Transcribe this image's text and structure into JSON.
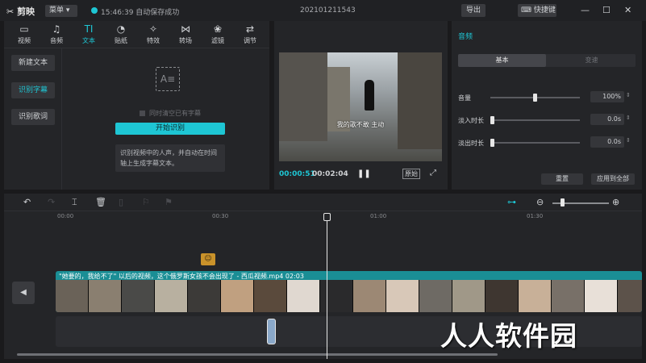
{
  "titlebar": {
    "logo": "剪映",
    "menu_label": "菜单",
    "save_status": "15:46:39 自动保存成功",
    "project_title": "202101211543",
    "export_label": "导出",
    "hotkey_label": "快捷键"
  },
  "media_panel": {
    "tabs": [
      {
        "label": "视频",
        "icon": "▭"
      },
      {
        "label": "音频",
        "icon": "♫"
      },
      {
        "label": "文本",
        "icon": "TI"
      },
      {
        "label": "贴纸",
        "icon": "◔"
      },
      {
        "label": "特效",
        "icon": "✧"
      },
      {
        "label": "转场",
        "icon": "⋈"
      },
      {
        "label": "滤镜",
        "icon": "❀"
      },
      {
        "label": "调节",
        "icon": "⇄"
      }
    ],
    "active_tab": "文本",
    "sidebar": [
      {
        "label": "新建文本"
      },
      {
        "label": "识别字幕"
      },
      {
        "label": "识别歌词"
      }
    ],
    "active_sidebar": "识别字幕",
    "ai_icon_glyph": "A≡",
    "checkbox_label": "同时清空已有字幕",
    "start_button": "开始识别",
    "hint": "识别视频中的人声，并自动在时间轴上生成字幕文本。"
  },
  "player": {
    "subtitle": "我的歌不敢  主动",
    "current_time": "00:00:51",
    "duration": "00:02:04",
    "original_label": "原始"
  },
  "properties": {
    "title": "音频",
    "segments": [
      "基本",
      "变速"
    ],
    "rows": [
      {
        "label": "音量",
        "value": "100%",
        "level": 0.5
      },
      {
        "label": "淡入时长",
        "value": "0.0s",
        "level": 0.0
      },
      {
        "label": "淡出时长",
        "value": "0.0s",
        "level": 0.0
      }
    ],
    "reset_label": "重置",
    "apply_label": "应用到全部"
  },
  "timeline": {
    "ruler": [
      "00:00",
      "00:30",
      "01:00",
      "01:30"
    ],
    "clip_title": "\"她要的，我给不了\"  以后的视频，这个俄罗斯女孩不会出现了 - 西瓜视频.mp4    02:03",
    "sticker_glyph": "☺",
    "mute_glyph": "◀",
    "playhead_time": "00:51",
    "zoom_level": 0.16,
    "frame_colors": [
      "#6a6258",
      "#8a7f70",
      "#4a4a48",
      "#b8b0a0",
      "#3c3a38",
      "#c0a080",
      "#5a4a3c",
      "#e0d8d0",
      "#2a2a2c",
      "#9c8874",
      "#d8c8b8",
      "#6e6a64",
      "#a09888",
      "#3e3630",
      "#c8b098",
      "#787068",
      "#e8e0d8",
      "#5c524a"
    ]
  },
  "watermark": "人人软件园"
}
